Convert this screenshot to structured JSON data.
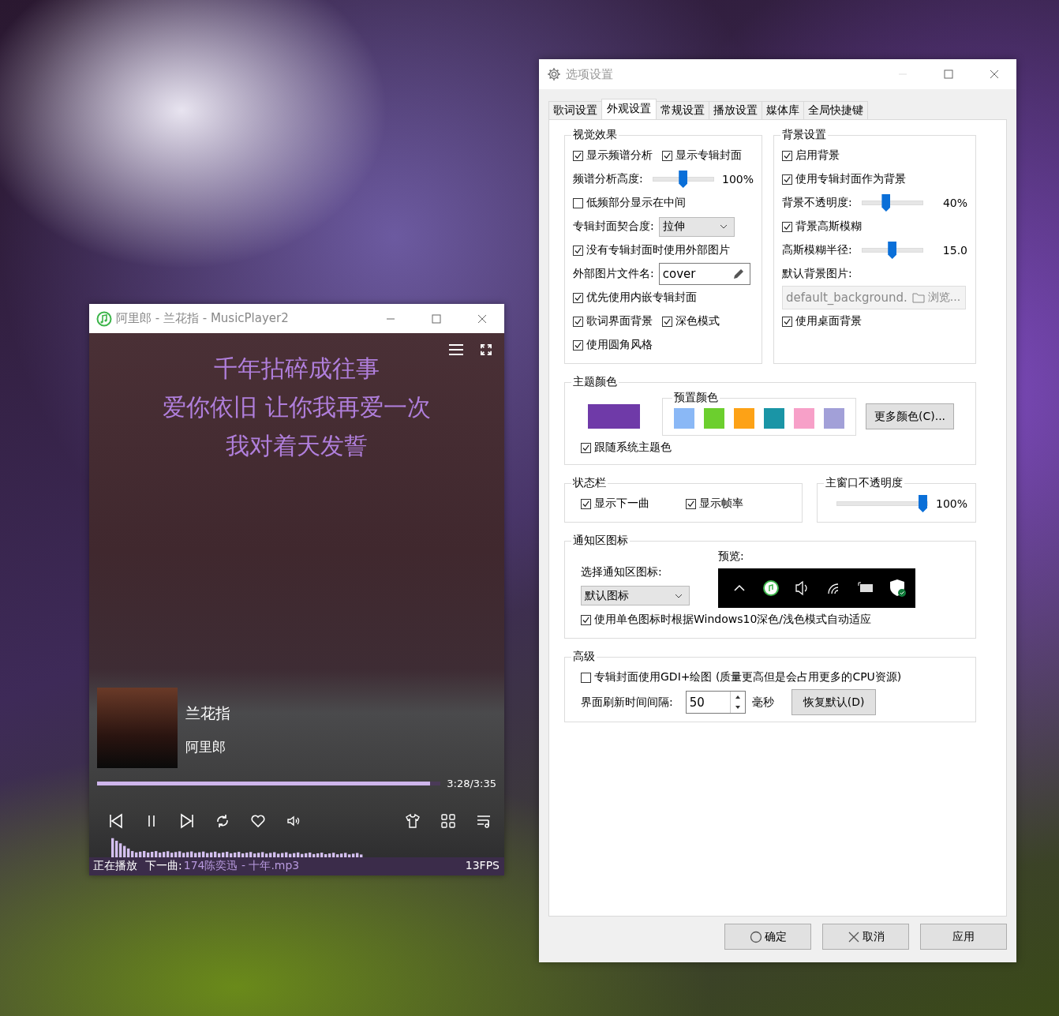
{
  "player": {
    "title": "阿里郎 - 兰花指 - MusicPlayer2",
    "lyrics": [
      "千年拈碎成往事",
      "爱你依旧 让你我再爱一次",
      "我对着天发誓"
    ],
    "song_title": "兰花指",
    "artist": "阿里郎",
    "progress": {
      "level": 0.97
    },
    "time": "3:28/3:35",
    "status": {
      "label": "正在播放",
      "next_label": "下一曲:",
      "next_song": "174陈奕迅 - 十年.mp3",
      "fps": "13FPS"
    }
  },
  "settings": {
    "title": "选项设置",
    "tabs": [
      {
        "label": "歌词设置",
        "selected": false
      },
      {
        "label": "外观设置",
        "selected": true
      },
      {
        "label": "常规设置",
        "selected": false
      },
      {
        "label": "播放设置",
        "selected": false
      },
      {
        "label": "媒体库",
        "selected": false
      },
      {
        "label": "全局快捷键",
        "selected": false
      }
    ],
    "top_groups": [
      {
        "title": "视觉效果",
        "rows": [
          {
            "kind": "checks",
            "items": [
              {
                "label": "显示频谱分析",
                "checked": true
              },
              {
                "label": "显示专辑封面",
                "checked": true
              }
            ]
          },
          {
            "kind": "slider",
            "label": "频谱分析高度:",
            "level": 0.5,
            "reading": "100%"
          },
          {
            "kind": "checks",
            "items": [
              {
                "label": "低频部分显示在中间",
                "checked": false
              }
            ]
          },
          {
            "kind": "select",
            "label": "专辑封面契合度:",
            "value": "拉伸"
          },
          {
            "kind": "checks",
            "items": [
              {
                "label": "没有专辑封面时使用外部图片",
                "checked": true
              }
            ]
          },
          {
            "kind": "input",
            "label": "外部图片文件名:",
            "value": "cover"
          },
          {
            "kind": "checks",
            "items": [
              {
                "label": "优先使用内嵌专辑封面",
                "checked": true
              }
            ]
          },
          {
            "kind": "checks",
            "items": [
              {
                "label": "歌词界面背景",
                "checked": true
              },
              {
                "label": "深色模式",
                "checked": true
              }
            ]
          },
          {
            "kind": "checks",
            "items": [
              {
                "label": "使用圆角风格",
                "checked": true
              }
            ]
          }
        ]
      },
      {
        "title": "背景设置",
        "rows": [
          {
            "kind": "checks",
            "items": [
              {
                "label": "启用背景",
                "checked": true
              }
            ]
          },
          {
            "kind": "checks",
            "items": [
              {
                "label": "使用专辑封面作为背景",
                "checked": true
              }
            ]
          },
          {
            "kind": "slider",
            "label": "背景不透明度:",
            "level": 0.38,
            "reading": "40%"
          },
          {
            "kind": "checks",
            "items": [
              {
                "label": "背景高斯模糊",
                "checked": true
              }
            ]
          },
          {
            "kind": "slider",
            "label": "高斯模糊半径:",
            "level": 0.5,
            "reading": "15.0"
          },
          {
            "kind": "label",
            "label": "默认背景图片:"
          },
          {
            "kind": "file",
            "value": "default_background.",
            "button": "浏览...",
            "disabled": true
          },
          {
            "kind": "checks",
            "items": [
              {
                "label": "使用桌面背景",
                "checked": true
              }
            ]
          }
        ]
      }
    ],
    "theme": {
      "title": "主题颜色",
      "color": "#6f3aa8",
      "presets_title": "预置颜色",
      "presets": [
        {
          "color": "#8ab8f6"
        },
        {
          "color": "#6ccf2e"
        },
        {
          "color": "#fda216"
        },
        {
          "color": "#1a95a6"
        },
        {
          "color": "#f7a0c8"
        },
        {
          "color": "#a2a0d8"
        }
      ],
      "more_button": "更多颜色(C)...",
      "follow_system": {
        "label": "跟随系统主题色",
        "checked": true
      }
    },
    "status_bar": {
      "title": "状态栏",
      "items": [
        {
          "label": "显示下一曲",
          "checked": true
        },
        {
          "label": "显示帧率",
          "checked": true
        }
      ]
    },
    "opacity": {
      "title": "主窗口不透明度",
      "level": 1,
      "reading": "100%"
    },
    "notify": {
      "title": "通知区图标",
      "select_label": "选择通知区图标:",
      "select_value": "默认图标",
      "preview_label": "预览:",
      "adapt": {
        "label": "使用单色图标时根据Windows10深色/浅色模式自动适应",
        "checked": true
      }
    },
    "advanced": {
      "title": "高级",
      "gdi": {
        "label": "专辑封面使用GDI+绘图 (质量更高但是会占用更多的CPU资源)",
        "checked": false
      },
      "interval_label": "界面刷新时间间隔:",
      "interval_value": "50",
      "unit": "毫秒",
      "restore_button": "恢复默认(D)"
    },
    "buttons": [
      {
        "kind": "ok",
        "label": "确定"
      },
      {
        "kind": "cancel",
        "label": "取消"
      },
      {
        "kind": "apply",
        "label": "应用"
      }
    ]
  }
}
